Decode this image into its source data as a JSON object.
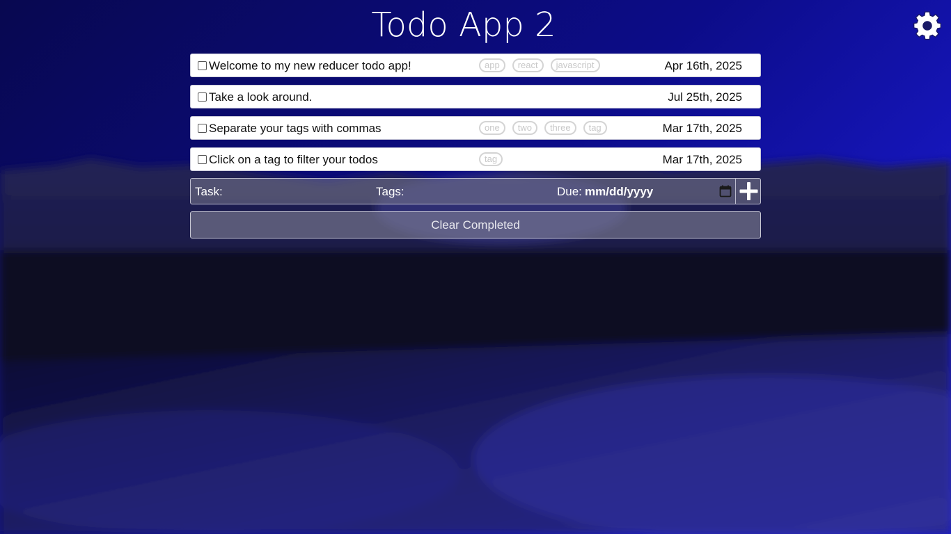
{
  "app": {
    "title": "Todo App 2"
  },
  "colors": {
    "sky_top": "#0a0a55",
    "sky_mid": "#1818b0",
    "ground": "#05052a"
  },
  "icons": {
    "settings": "gear-icon",
    "calendar": "calendar-icon",
    "add": "plus-icon"
  },
  "todos": [
    {
      "text": "Welcome to my new reducer todo app!",
      "tags": [
        "app",
        "react",
        "javascript"
      ],
      "due": "Apr 16th, 2025",
      "completed": false
    },
    {
      "text": "Take a look around.",
      "tags": [],
      "due": "Jul 25th, 2025",
      "completed": false
    },
    {
      "text": "Separate your tags with commas",
      "tags": [
        "one",
        "two",
        "three",
        "tag"
      ],
      "due": "Mar 17th, 2025",
      "completed": false
    },
    {
      "text": "Click on a tag to filter your todos",
      "tags": [
        "tag"
      ],
      "due": "Mar 17th, 2025",
      "completed": false
    }
  ],
  "form": {
    "task_label": "Task:",
    "tags_label": "Tags:",
    "due_label": "Due:",
    "due_placeholder": "mm/dd/yyyy",
    "task_value": "",
    "tags_value": ""
  },
  "clear_button": {
    "label": "Clear Completed"
  }
}
